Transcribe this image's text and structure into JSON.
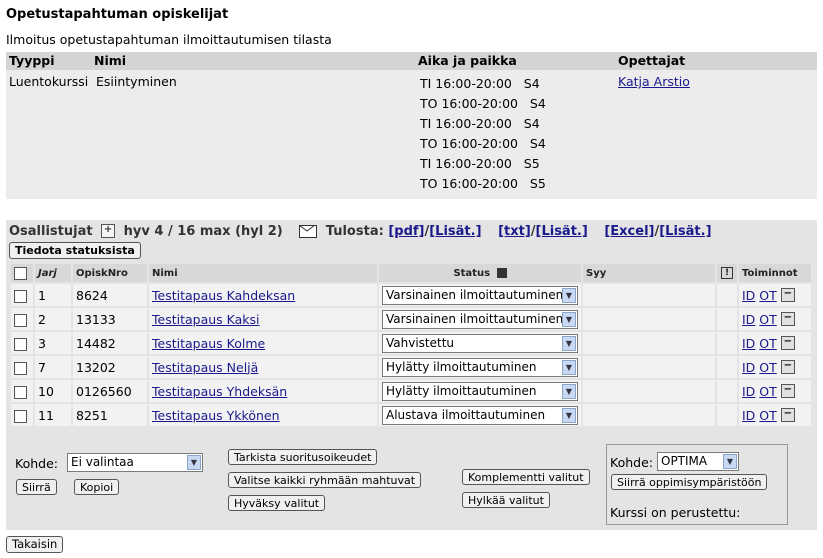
{
  "page": {
    "title": "Opetustapahtuman opiskelijat",
    "subtitle": "Ilmoitus opetustapahtuman ilmoittautumisen tilasta"
  },
  "event": {
    "headers": {
      "type": "Tyyppi",
      "name": "Nimi",
      "time": "Aika ja paikka",
      "teachers": "Opettajat"
    },
    "type": "Luentokurssi",
    "name": "Esiintyminen",
    "teacher": "Katja Arstio",
    "schedule": [
      "TI 16:00-20:00   S4",
      "TO 16:00-20:00   S4",
      "TI 16:00-20:00   S4",
      "TO 16:00-20:00   S4",
      "TI 16:00-20:00   S5",
      "TO 16:00-20:00   S5"
    ]
  },
  "participants": {
    "label": "Osallistujat",
    "counts": "hyv 4 / 16 max (hyl 2)",
    "print_label": "Tulosta:",
    "pdf": "[pdf]",
    "txt": "[txt]",
    "excel": "[Excel]",
    "more": "[Lisät.]",
    "notify_button": "Tiedota statuksista",
    "columns": {
      "order": "Jarj",
      "number": "OpiskNro",
      "name": "Nimi",
      "status": "Status",
      "reason": "Syy",
      "actions": "Toiminnot"
    },
    "id_link": "ID",
    "ot_link": "OT",
    "rows": [
      {
        "order": "1",
        "number": "8624",
        "name": "Testitapaus Kahdeksan",
        "status": "Varsinainen ilmoittautuminen"
      },
      {
        "order": "2",
        "number": "13133",
        "name": "Testitapaus Kaksi",
        "status": "Varsinainen ilmoittautuminen"
      },
      {
        "order": "3",
        "number": "14482",
        "name": "Testitapaus Kolme",
        "status": "Vahvistettu"
      },
      {
        "order": "7",
        "number": "13202",
        "name": "Testitapaus Neljä",
        "status": "Hylätty ilmoittautuminen"
      },
      {
        "order": "10",
        "number": "0126560",
        "name": "Testitapaus Yhdeksän",
        "status": "Hylätty ilmoittautuminen"
      },
      {
        "order": "11",
        "number": "8251",
        "name": "Testitapaus Ykkönen",
        "status": "Alustava ilmoittautuminen"
      }
    ]
  },
  "bottom": {
    "kohde_label": "Kohde:",
    "kohde_value": "Ei valintaa",
    "move_button": "Siirrä",
    "copy_button": "Kopioi",
    "check_rights_button": "Tarkista suoritusoikeudet",
    "select_all_button": "Valitse kaikki ryhmään mahtuvat",
    "accept_button": "Hyväksy valitut",
    "complement_button": "Komplementti valitut",
    "reject_button": "Hylkää valitut",
    "kohde2_label": "Kohde:",
    "kohde2_value": "OPTIMA",
    "move_env_button": "Siirrä oppimisympäristöön",
    "course_status": "Kurssi on perustettu:"
  },
  "back_button": "Takaisin"
}
